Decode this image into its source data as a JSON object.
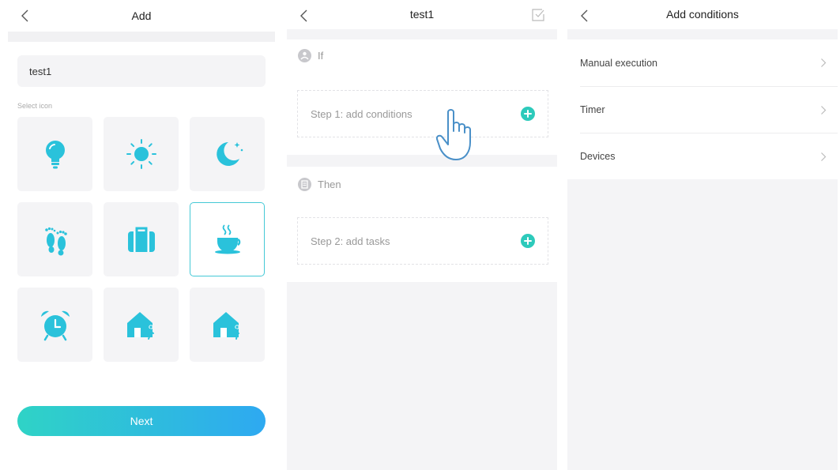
{
  "add_screen": {
    "title": "Add",
    "name_value": "test1",
    "select_icon_label": "Select icon",
    "icons": [
      "bulb-icon",
      "sun-icon",
      "moon-stars-icon",
      "footprints-icon",
      "suitcase-icon",
      "coffee-cup-icon",
      "alarm-clock-icon",
      "home-leave-icon",
      "home-arrive-icon"
    ],
    "selected_icon": "coffee-cup-icon",
    "next_label": "Next"
  },
  "scene_screen": {
    "title": "test1",
    "if_label": "If",
    "step1_label": "Step 1: add conditions",
    "then_label": "Then",
    "step2_label": "Step 2: add tasks"
  },
  "conditions_screen": {
    "title": "Add conditions",
    "items": [
      {
        "label": "Manual execution"
      },
      {
        "label": "Timer"
      },
      {
        "label": "Devices"
      }
    ]
  },
  "colors": {
    "accent": "#2ac2db",
    "plus": "#2dcabb",
    "gradient_start": "#2fd3c6",
    "gradient_end": "#2ea9f1"
  }
}
